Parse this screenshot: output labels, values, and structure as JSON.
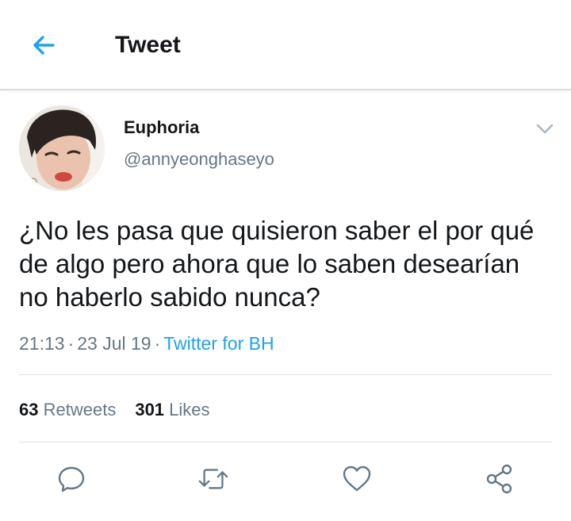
{
  "header": {
    "title": "Tweet",
    "back_icon": "arrow-left-icon"
  },
  "user": {
    "display_name": "Euphoria",
    "handle": "@annyeonghaseyo",
    "avatar": "avatar-photo"
  },
  "tweet": {
    "text": "¿No les pasa que quisieron saber el por qué de algo pero ahora que lo saben desearían no haberlo sabido nunca?",
    "time": "21:13",
    "date": "23 Jul 19",
    "separator": "·",
    "source": "Twitter for BH"
  },
  "stats": {
    "retweets_count": "63",
    "retweets_label": "Retweets",
    "likes_count": "301",
    "likes_label": "Likes"
  },
  "actions": [
    {
      "name": "reply",
      "icon": "reply-icon"
    },
    {
      "name": "retweet",
      "icon": "retweet-icon"
    },
    {
      "name": "like",
      "icon": "heart-icon"
    },
    {
      "name": "share",
      "icon": "share-icon"
    }
  ],
  "colors": {
    "accent": "#1da1f2",
    "text": "#14171a",
    "secondary": "#657786",
    "divider": "#dfe3e6"
  }
}
